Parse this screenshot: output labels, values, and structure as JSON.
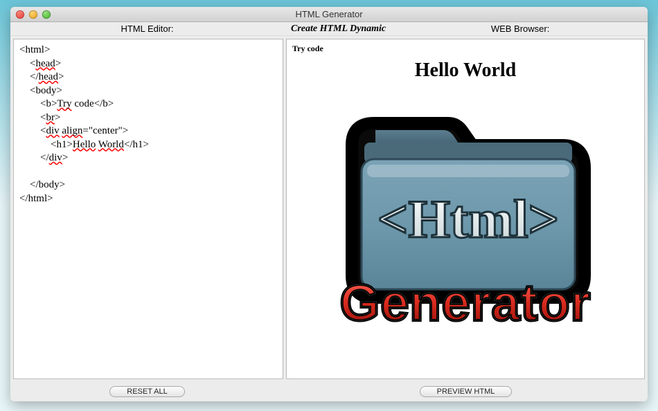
{
  "window": {
    "title": "HTML Generator"
  },
  "header": {
    "left_label": "HTML Editor:",
    "center_label": "Create HTML Dynamic",
    "right_label": "WEB Browser:"
  },
  "editor": {
    "code": "<html>\n    <head>\n    </head>\n    <body>\n        <b>Try code</b>\n        <br>\n        <div align=\"center\">\n            <h1>Hello World</h1>\n        </div>\n\n    </body>\n</html>"
  },
  "preview": {
    "try_code_text": "Try code",
    "heading_text": "Hello World",
    "logo_top_text": "<Html>",
    "logo_bottom_text": "Generator"
  },
  "buttons": {
    "reset_all": "RESET ALL",
    "preview_html": "PREVIEW HTML"
  }
}
